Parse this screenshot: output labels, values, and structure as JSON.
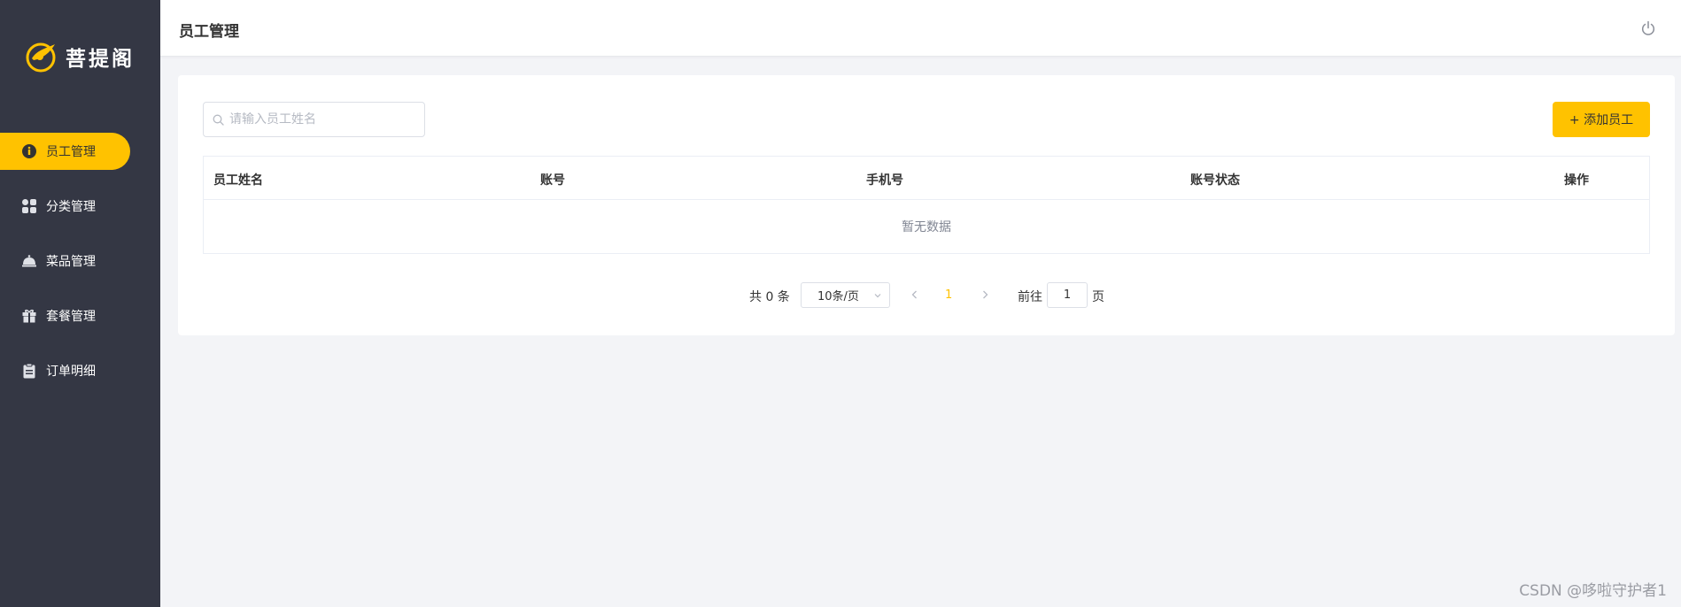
{
  "brand": {
    "name": "菩提阁",
    "accent": "#ffc200",
    "sidebar_bg": "#343744"
  },
  "sidebar": {
    "items": [
      {
        "label": "员工管理",
        "icon": "employee-icon",
        "active": true
      },
      {
        "label": "分类管理",
        "icon": "category-grid-icon",
        "active": false
      },
      {
        "label": "菜品管理",
        "icon": "dish-cloche-icon",
        "active": false
      },
      {
        "label": "套餐管理",
        "icon": "gift-package-icon",
        "active": false
      },
      {
        "label": "订单明细",
        "icon": "clipboard-icon",
        "active": false
      }
    ]
  },
  "header": {
    "title": "员工管理",
    "icon": "power-icon"
  },
  "toolbar": {
    "search_placeholder": "请输入员工姓名",
    "search_value": "",
    "add_label": "+ 添加员工"
  },
  "table": {
    "columns": [
      "员工姓名",
      "账号",
      "手机号",
      "账号状态",
      "操作"
    ],
    "rows": [],
    "empty_text": "暂无数据"
  },
  "pagination": {
    "total_label": "共 0 条",
    "page_size_label": "10条/页",
    "current_page": "1",
    "goto_label": "前往",
    "goto_value": "1",
    "page_unit": "页"
  },
  "watermark": "CSDN @哆啦守护者1"
}
